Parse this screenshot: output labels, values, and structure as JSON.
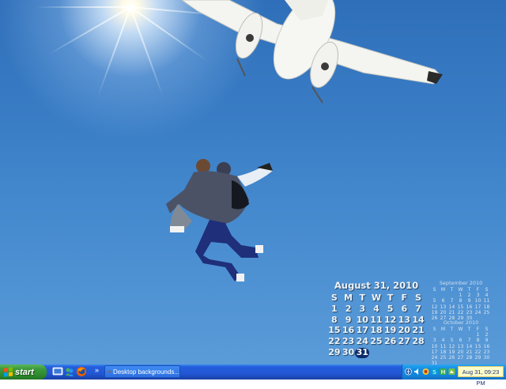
{
  "desktop": {
    "wallpaper": "skydive-photo"
  },
  "calendar_current": {
    "title": "August 31, 2010",
    "weekdays": [
      "S",
      "M",
      "T",
      "W",
      "T",
      "F",
      "S"
    ],
    "days": [
      "1",
      "2",
      "3",
      "4",
      "5",
      "6",
      "7",
      "8",
      "9",
      "10",
      "11",
      "12",
      "13",
      "14",
      "15",
      "16",
      "17",
      "18",
      "19",
      "20",
      "21",
      "22",
      "23",
      "24",
      "25",
      "26",
      "27",
      "28",
      "29",
      "30",
      "31"
    ],
    "today": "31",
    "first_weekday_index": 0
  },
  "calendar_next": {
    "title": "September 2010",
    "weekdays": [
      "S",
      "M",
      "T",
      "W",
      "T",
      "F",
      "S"
    ],
    "days": [
      "1",
      "2",
      "3",
      "4",
      "5",
      "6",
      "7",
      "8",
      "9",
      "10",
      "11",
      "12",
      "13",
      "14",
      "15",
      "16",
      "17",
      "18",
      "19",
      "20",
      "21",
      "22",
      "23",
      "24",
      "25",
      "26",
      "27",
      "28",
      "29",
      "30"
    ],
    "first_weekday_index": 3
  },
  "calendar_after": {
    "title": "October 2010",
    "weekdays": [
      "S",
      "M",
      "T",
      "W",
      "T",
      "F",
      "S"
    ],
    "days": [
      "1",
      "2",
      "3",
      "4",
      "5",
      "6",
      "7",
      "8",
      "9",
      "10",
      "11",
      "12",
      "13",
      "14",
      "15",
      "16",
      "17",
      "18",
      "19",
      "20",
      "21",
      "22",
      "23",
      "24",
      "25",
      "26",
      "27",
      "28",
      "29",
      "30",
      "31"
    ],
    "first_weekday_index": 5
  },
  "taskbar": {
    "start_label": "start",
    "quicklaunch_chevron": "»",
    "task_label": "Desktop backgrounds...",
    "clock": "Aug 31, 09:23 PM",
    "colors": {
      "taskbar": "#245edc",
      "start": "#3c9a3c",
      "tray": "#148ee3",
      "clock_bg": "#fffec8"
    }
  }
}
